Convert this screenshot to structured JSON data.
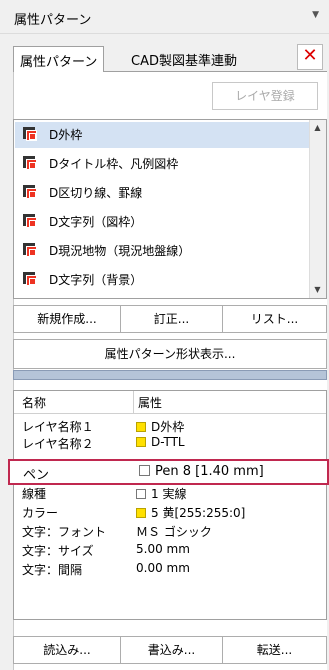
{
  "panel": {
    "title": "属性パターン"
  },
  "tabs": [
    {
      "label": "属性パターン"
    },
    {
      "label": "CAD製図基準連動"
    }
  ],
  "buttons": {
    "layer_register": "レイヤ登録",
    "new": "新規作成...",
    "edit": "訂正...",
    "list": "リスト...",
    "shape_display": "属性パターン形状表示...",
    "read": "読込み...",
    "write": "書込み...",
    "transfer": "転送..."
  },
  "patterns": [
    {
      "label": "D外枠",
      "selected": true
    },
    {
      "label": "Dタイトル枠、凡例図枠"
    },
    {
      "label": "D区切り線、罫線"
    },
    {
      "label": "D文字列（図枠）"
    },
    {
      "label": "D現況地物（現況地盤線）"
    },
    {
      "label": "D文字列（背景）"
    }
  ],
  "table": {
    "headers": {
      "name": "名称",
      "attr": "属性"
    },
    "rows": [
      {
        "name": "レイヤ名称１",
        "value": "D外枠",
        "swatch": "#ffe000"
      },
      {
        "name": "レイヤ名称２",
        "value": "D-TTL",
        "swatch": "#ffe000"
      },
      {
        "name": "ペン",
        "value": "Pen 8  [1.40 mm]",
        "swatch": "#ffffff",
        "highlight": true
      },
      {
        "name": "線種",
        "value": "1  実線",
        "swatch": "#ffffff"
      },
      {
        "name": "カラー",
        "value": "5  黄[255:255:0]",
        "swatch": "#ffe000"
      },
      {
        "name": "文字：フォント",
        "value": "ＭＳ ゴシック"
      },
      {
        "name": "文字：サイズ",
        "value": "5.00 mm"
      },
      {
        "name": "文字：間隔",
        "value": "0.00 mm"
      }
    ]
  }
}
